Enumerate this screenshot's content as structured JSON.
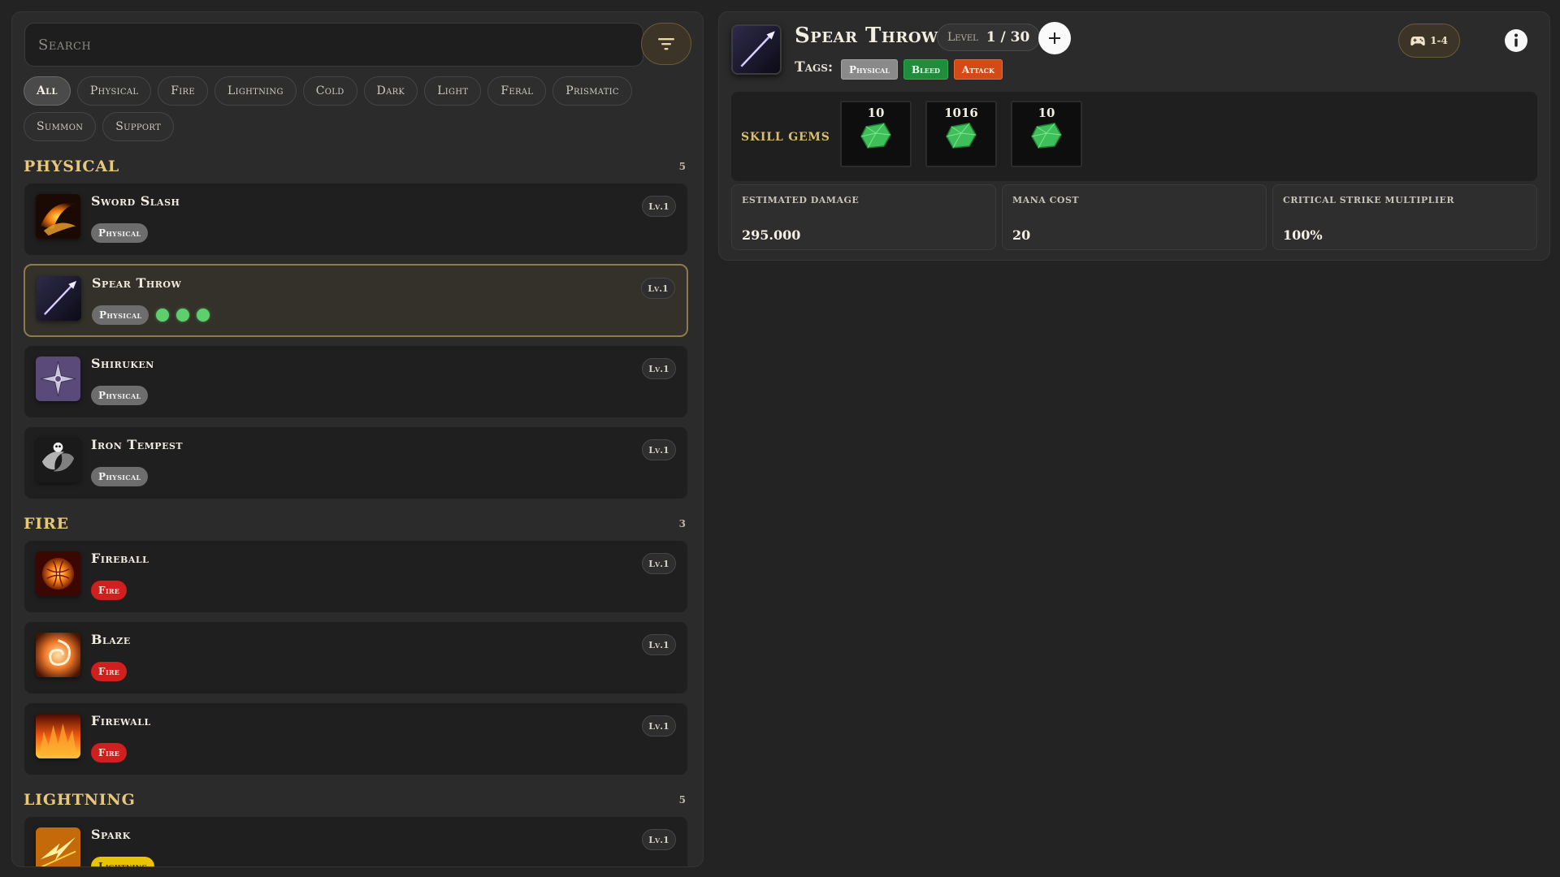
{
  "search": {
    "placeholder": "Search"
  },
  "filters": [
    "All",
    "Physical",
    "Fire",
    "Lightning",
    "Cold",
    "Dark",
    "Light",
    "Feral",
    "Prismatic",
    "Summon",
    "Support"
  ],
  "active_filter": "All",
  "groups": [
    {
      "title": "PHYSICAL",
      "count": "5",
      "skills": [
        {
          "name": "Sword Slash",
          "tag": "Physical",
          "level": "Lv.1",
          "icon": "sword-slash-icon"
        },
        {
          "name": "Spear Throw",
          "tag": "Physical",
          "level": "Lv.1",
          "icon": "spear-icon",
          "gems": 3,
          "selected": true
        },
        {
          "name": "Shiruken",
          "tag": "Physical",
          "level": "Lv.1",
          "icon": "shuriken-icon"
        },
        {
          "name": "Iron Tempest",
          "tag": "Physical",
          "level": "Lv.1",
          "icon": "iron-tempest-icon"
        }
      ]
    },
    {
      "title": "FIRE",
      "count": "3",
      "skills": [
        {
          "name": "Fireball",
          "tag": "Fire",
          "level": "Lv.1",
          "icon": "fireball-icon"
        },
        {
          "name": "Blaze",
          "tag": "Fire",
          "level": "Lv.1",
          "icon": "blaze-icon"
        },
        {
          "name": "Firewall",
          "tag": "Fire",
          "level": "Lv.1",
          "icon": "firewall-icon"
        }
      ]
    },
    {
      "title": "LIGHTNING",
      "count": "5",
      "skills": [
        {
          "name": "Spark",
          "tag": "Lightning",
          "level": "Lv.1",
          "icon": "spark-icon"
        }
      ]
    }
  ],
  "detail": {
    "title": "Spear Throw",
    "level_label": "Level",
    "level_value": "1 / 30",
    "tags_label": "Tags:",
    "tags": [
      "Physical",
      "Bleed",
      "Attack"
    ],
    "player_count": "1-4",
    "skill_gems_label": "SKILL GEMS",
    "gems": [
      "10",
      "1016",
      "10"
    ],
    "stats": [
      {
        "label": "ESTIMATED DAMAGE",
        "value": "295.000"
      },
      {
        "label": "MANA COST",
        "value": "20"
      },
      {
        "label": "CRITICAL STRIKE MULTIPLIER",
        "value": "100%"
      }
    ]
  },
  "colors": {
    "accent_gold": "#e8c77a",
    "tag_physical": "#6d6d6d",
    "tag_fire": "#cf1f1f",
    "tag_lightning": "#e8c400",
    "tag_bleed": "#1f8d3c",
    "tag_attack": "#d24a16",
    "gem_green": "#5fcf6e"
  }
}
